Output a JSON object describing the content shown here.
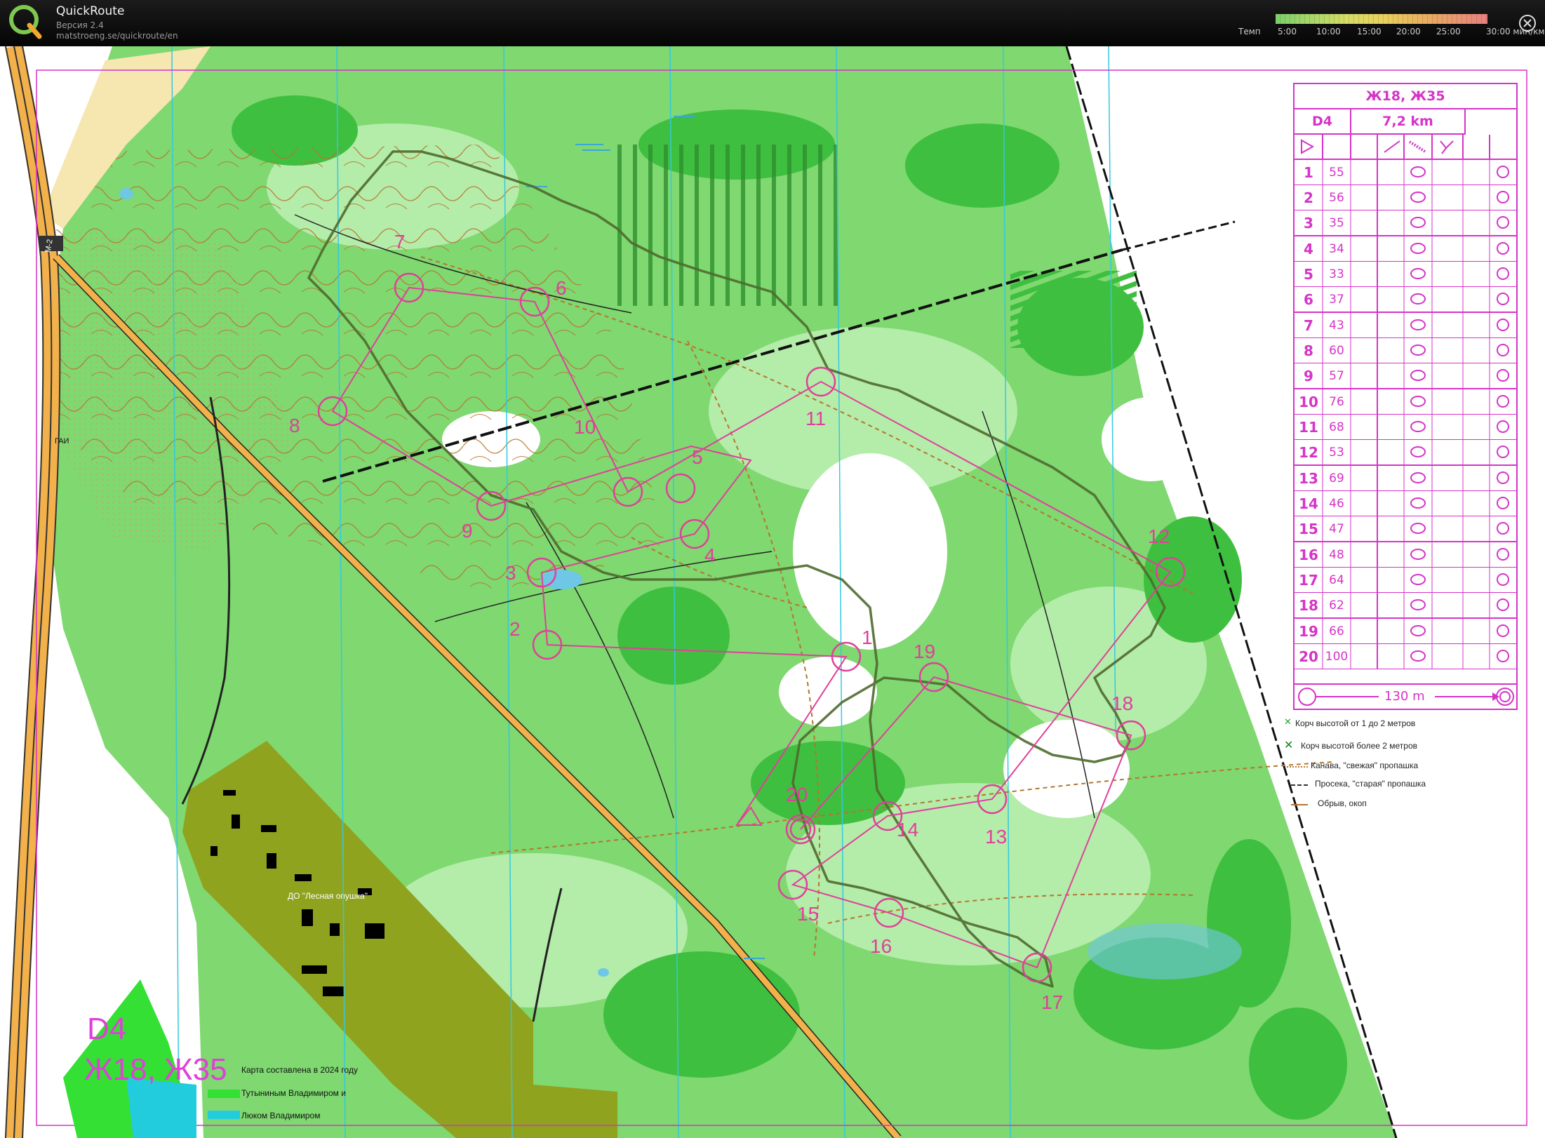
{
  "app": {
    "name": "QuickRoute",
    "version": "Версия 2.4",
    "url": "matstroeng.se/quickroute/en"
  },
  "pace_scale": {
    "label": "Темп",
    "ticks": [
      "5:00",
      "10:00",
      "15:00",
      "20:00",
      "25:00",
      "30:00"
    ],
    "unit": "мин/км"
  },
  "descriptions": {
    "title": "Ж18, Ж35",
    "course_code": "D4",
    "length": "7,2 km",
    "rows": [
      {
        "n": "1",
        "code": "55"
      },
      {
        "n": "2",
        "code": "56"
      },
      {
        "n": "3",
        "code": "35"
      },
      {
        "n": "4",
        "code": "34"
      },
      {
        "n": "5",
        "code": "33"
      },
      {
        "n": "6",
        "code": "37"
      },
      {
        "n": "7",
        "code": "43"
      },
      {
        "n": "8",
        "code": "60"
      },
      {
        "n": "9",
        "code": "57"
      },
      {
        "n": "10",
        "code": "76"
      },
      {
        "n": "11",
        "code": "68"
      },
      {
        "n": "12",
        "code": "53"
      },
      {
        "n": "13",
        "code": "69"
      },
      {
        "n": "14",
        "code": "46"
      },
      {
        "n": "15",
        "code": "47"
      },
      {
        "n": "16",
        "code": "48"
      },
      {
        "n": "17",
        "code": "64"
      },
      {
        "n": "18",
        "code": "62"
      },
      {
        "n": "19",
        "code": "66"
      },
      {
        "n": "20",
        "code": "100"
      }
    ],
    "finish_distance": "130 m"
  },
  "legend": [
    "Корч высотой от 1 до 2 метров",
    "Корч высотой более 2 метров",
    "Канава, \"свежая\" пропашка",
    "Просека, \"старая\" пропашка",
    "Обрыв, окоп"
  ],
  "map_labels": {
    "road": "М-2",
    "gai": "ГАИ",
    "village": "ДО \"Лесная опушка\""
  },
  "controls": [
    "1",
    "2",
    "3",
    "4",
    "5",
    "6",
    "7",
    "8",
    "9",
    "10",
    "11",
    "12",
    "13",
    "14",
    "15",
    "16",
    "17",
    "18",
    "19",
    "20"
  ],
  "credits": {
    "line1": "Карта составлена в 2024 году",
    "line2": "Тутыниным Владимиром и",
    "line3": "Люком Владимиром"
  },
  "course_overlay": {
    "code": "D4",
    "classes": "Ж18, Ж35"
  },
  "colors": {
    "course": "#e0409a",
    "forest": "#3fbf3f",
    "open": "#ffffff",
    "contours": "#b5762f",
    "settlement": "#8fa31f",
    "route": "#556b2f"
  }
}
